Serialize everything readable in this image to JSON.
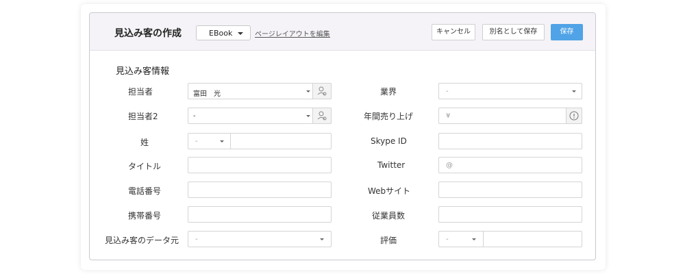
{
  "header": {
    "title": "見込み客の作成",
    "layout_value": "EBook",
    "edit_layout_link": "ページレイアウトを編集",
    "cancel_label": "キャンセル",
    "save_as_label": "別名として保存",
    "save_label": "保存",
    "accent_color": "#4fa3e6"
  },
  "section": {
    "title": "見込み客情報"
  },
  "left_fields": {
    "owner": {
      "label": "担当者",
      "value": "富田　光"
    },
    "owner2": {
      "label": "担当者2",
      "value": "-"
    },
    "last_name": {
      "label": "姓",
      "salutation": "-",
      "value": ""
    },
    "title": {
      "label": "タイトル",
      "value": ""
    },
    "phone": {
      "label": "電話番号",
      "value": ""
    },
    "mobile": {
      "label": "携帯番号",
      "value": ""
    },
    "lead_source": {
      "label": "見込み客のデータ元",
      "value": "-"
    }
  },
  "right_fields": {
    "industry": {
      "label": "業界",
      "value": "-"
    },
    "annual_revenue": {
      "label": "年間売り上げ",
      "prefix": "¥"
    },
    "skype": {
      "label": "Skype ID",
      "value": ""
    },
    "twitter": {
      "label": "Twitter",
      "prefix": "@"
    },
    "website": {
      "label": "Webサイト",
      "value": ""
    },
    "employees": {
      "label": "従業員数",
      "value": ""
    },
    "rating": {
      "label": "評価",
      "value": "-"
    }
  },
  "icons": {
    "lookup": "user-lookup-icon",
    "info": "info-icon",
    "dropdown": "chevron-down-icon"
  }
}
